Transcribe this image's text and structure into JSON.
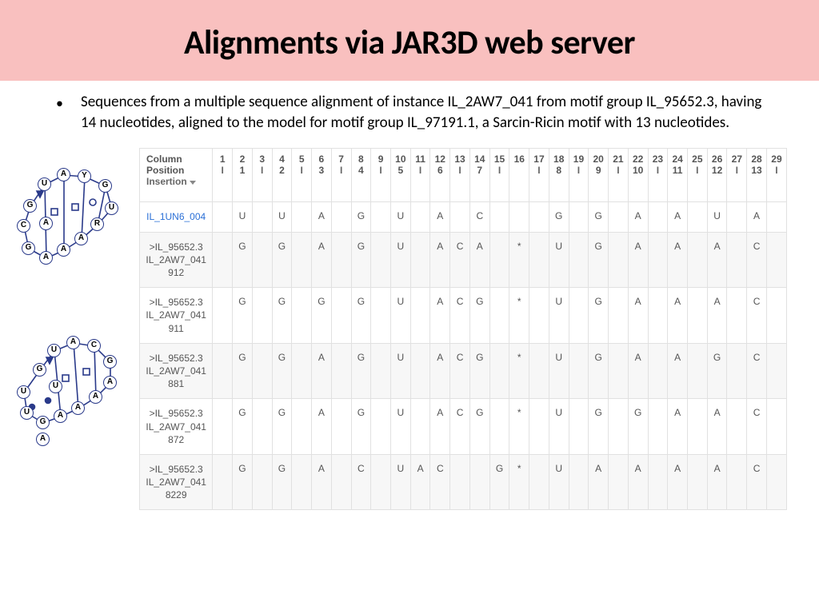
{
  "title": "Alignments via JAR3D web server",
  "bullet": "Sequences from a multiple sequence alignment of instance IL_2AW7_041 from motif group IL_95652.3, having 14 nucleotides, aligned to the model for motif group IL_97191.1, a Sarcin-Ricin motif with 13 nucleotides.",
  "table": {
    "header_labels": {
      "column": "Column",
      "position": "Position",
      "insertion": "Insertion"
    },
    "columns": [
      {
        "col": "1",
        "pos": "",
        "ins": "I"
      },
      {
        "col": "2",
        "pos": "1",
        "ins": ""
      },
      {
        "col": "3",
        "pos": "",
        "ins": "I"
      },
      {
        "col": "4",
        "pos": "2",
        "ins": ""
      },
      {
        "col": "5",
        "pos": "",
        "ins": "I"
      },
      {
        "col": "6",
        "pos": "3",
        "ins": ""
      },
      {
        "col": "7",
        "pos": "",
        "ins": "I"
      },
      {
        "col": "8",
        "pos": "4",
        "ins": ""
      },
      {
        "col": "9",
        "pos": "",
        "ins": "I"
      },
      {
        "col": "10",
        "pos": "5",
        "ins": ""
      },
      {
        "col": "11",
        "pos": "",
        "ins": "I"
      },
      {
        "col": "12",
        "pos": "6",
        "ins": ""
      },
      {
        "col": "13",
        "pos": "",
        "ins": "I"
      },
      {
        "col": "14",
        "pos": "7",
        "ins": ""
      },
      {
        "col": "15",
        "pos": "",
        "ins": "I"
      },
      {
        "col": "16",
        "pos": "",
        "ins": ""
      },
      {
        "col": "17",
        "pos": "",
        "ins": "I"
      },
      {
        "col": "18",
        "pos": "8",
        "ins": ""
      },
      {
        "col": "19",
        "pos": "",
        "ins": "I"
      },
      {
        "col": "20",
        "pos": "9",
        "ins": ""
      },
      {
        "col": "21",
        "pos": "",
        "ins": "I"
      },
      {
        "col": "22",
        "pos": "10",
        "ins": ""
      },
      {
        "col": "23",
        "pos": "",
        "ins": "I"
      },
      {
        "col": "24",
        "pos": "11",
        "ins": ""
      },
      {
        "col": "25",
        "pos": "",
        "ins": "I"
      },
      {
        "col": "26",
        "pos": "12",
        "ins": ""
      },
      {
        "col": "27",
        "pos": "",
        "ins": "I"
      },
      {
        "col": "28",
        "pos": "13",
        "ins": ""
      },
      {
        "col": "29",
        "pos": "",
        "ins": "I"
      }
    ],
    "rows": [
      {
        "label": "IL_1UN6_004",
        "link": true,
        "cells": [
          "",
          "U",
          "",
          "U",
          "",
          "A",
          "",
          "G",
          "",
          "U",
          "",
          "A",
          "",
          "C",
          "",
          "",
          "",
          "G",
          "",
          "G",
          "",
          "A",
          "",
          "A",
          "",
          "U",
          "",
          "A",
          ""
        ]
      },
      {
        "label": ">IL_95652.3 IL_2AW7_041 912",
        "link": false,
        "cells": [
          "",
          "G",
          "",
          "G",
          "",
          "A",
          "",
          "G",
          "",
          "U",
          "",
          "A",
          "C",
          "A",
          "",
          "*",
          "",
          "U",
          "",
          "G",
          "",
          "A",
          "",
          "A",
          "",
          "A",
          "",
          "C",
          ""
        ]
      },
      {
        "label": ">IL_95652.3 IL_2AW7_041 911",
        "link": false,
        "cells": [
          "",
          "G",
          "",
          "G",
          "",
          "G",
          "",
          "G",
          "",
          "U",
          "",
          "A",
          "C",
          "G",
          "",
          "*",
          "",
          "U",
          "",
          "G",
          "",
          "A",
          "",
          "A",
          "",
          "A",
          "",
          "C",
          ""
        ]
      },
      {
        "label": ">IL_95652.3 IL_2AW7_041 881",
        "link": false,
        "cells": [
          "",
          "G",
          "",
          "G",
          "",
          "A",
          "",
          "G",
          "",
          "U",
          "",
          "A",
          "C",
          "G",
          "",
          "*",
          "",
          "U",
          "",
          "G",
          "",
          "A",
          "",
          "A",
          "",
          "G",
          "",
          "C",
          ""
        ]
      },
      {
        "label": ">IL_95652.3 IL_2AW7_041 872",
        "link": false,
        "cells": [
          "",
          "G",
          "",
          "G",
          "",
          "A",
          "",
          "G",
          "",
          "U",
          "",
          "A",
          "C",
          "G",
          "",
          "*",
          "",
          "U",
          "",
          "G",
          "",
          "G",
          "",
          "A",
          "",
          "A",
          "",
          "C",
          ""
        ]
      },
      {
        "label": ">IL_95652.3 IL_2AW7_041 8229",
        "link": false,
        "cells": [
          "",
          "G",
          "",
          "G",
          "",
          "A",
          "",
          "C",
          "",
          "U",
          "A",
          "C",
          "",
          "",
          "G",
          "*",
          "",
          "U",
          "",
          "A",
          "",
          "A",
          "",
          "A",
          "",
          "A",
          "",
          "C",
          ""
        ]
      }
    ]
  },
  "motif1_nodes": [
    "G",
    "U",
    "A",
    "Y",
    "G",
    "U",
    "R",
    "A",
    "A",
    "A",
    "A",
    "G",
    "C"
  ],
  "motif2_nodes": [
    "G",
    "U",
    "A",
    "C",
    "G",
    "A",
    "A",
    "A",
    "A",
    "G",
    "U",
    "U",
    "U",
    "A"
  ]
}
